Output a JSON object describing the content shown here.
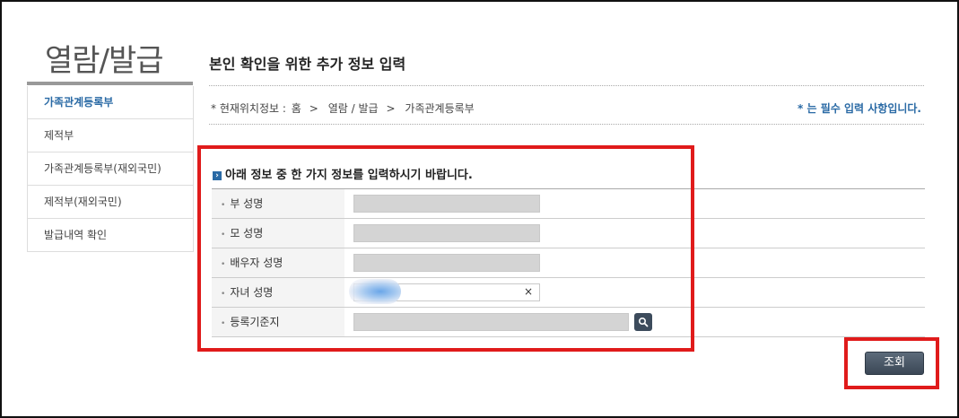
{
  "sidebar": {
    "title": "열람/발급",
    "items": [
      {
        "label": "가족관계등록부"
      },
      {
        "label": "제적부"
      },
      {
        "label": "가족관계등록부(재외국민)"
      },
      {
        "label": "제적부(재외국민)"
      },
      {
        "label": "발급내역 확인"
      }
    ]
  },
  "main": {
    "title": "본인 확인을 위한 추가 정보 입력",
    "breadcrumb": {
      "prefix": "* 현재위치정보 :",
      "parts": [
        "홈",
        "열람 / 발급",
        "가족관계등록부"
      ],
      "separator": ">"
    },
    "required_note": "* 는 필수 입력 사항입니다.",
    "form_heading": "아래 정보 중 한 가지 정보를 입력하시기 바랍니다.",
    "fields": [
      {
        "label": "부 성명"
      },
      {
        "label": "모 성명"
      },
      {
        "label": "배우자 성명"
      },
      {
        "label": "자녀 성명",
        "clear_icon": "×"
      },
      {
        "label": "등록기준지",
        "icon": "search-icon"
      }
    ],
    "submit_label": "조회"
  },
  "colors": {
    "highlight": "#e01b1b",
    "accent": "#2a6aa5",
    "button": "#3b4756"
  }
}
